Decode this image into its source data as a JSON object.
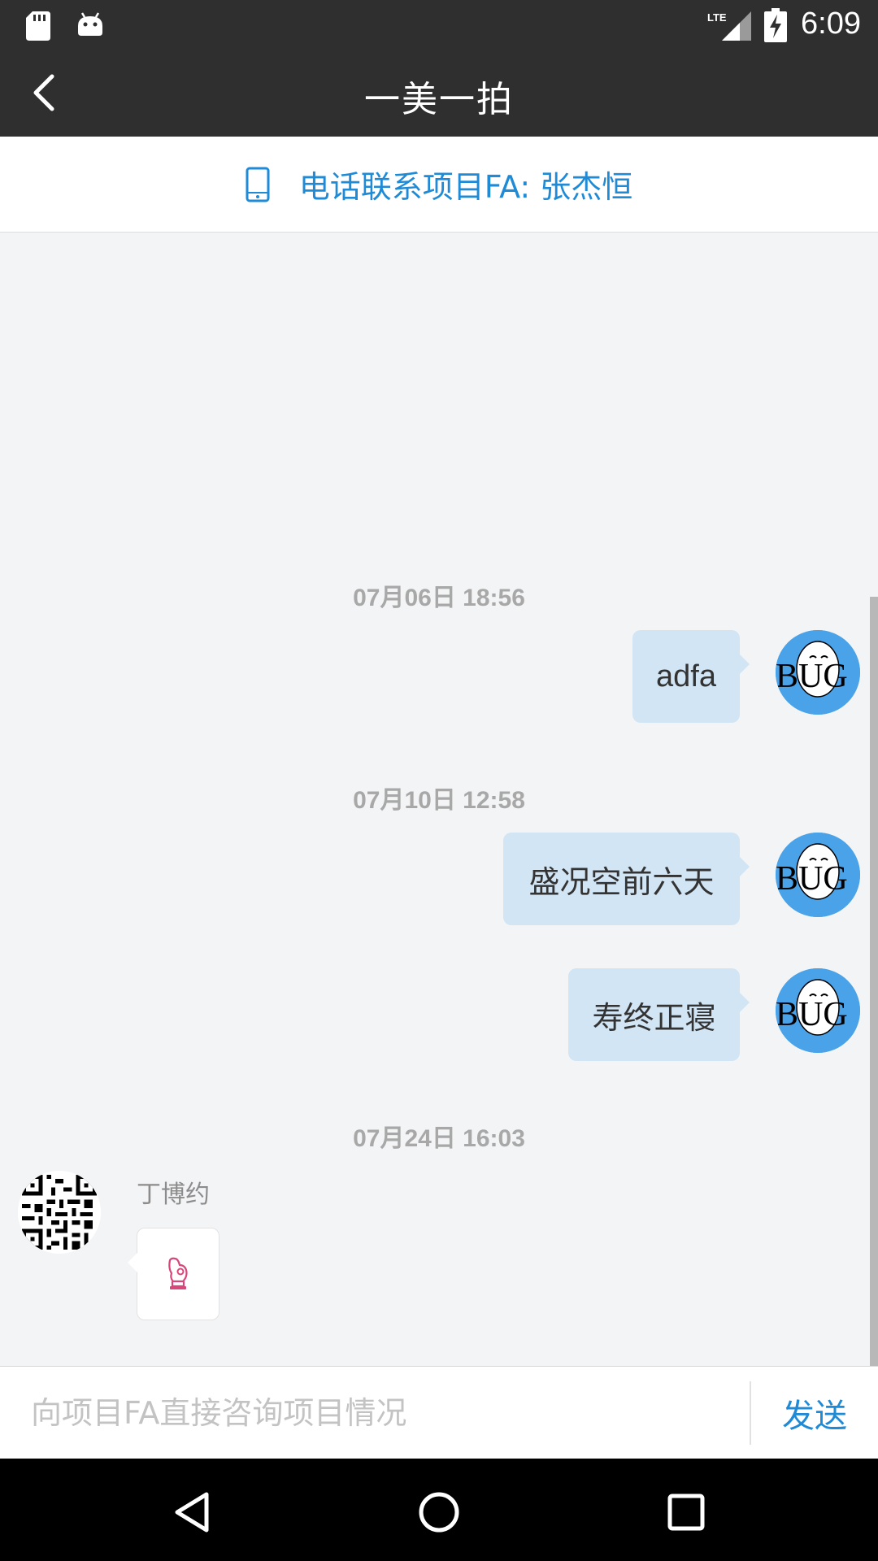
{
  "status_bar": {
    "time": "6:09",
    "network": "LTE",
    "icons": [
      "sd-card-icon",
      "android-icon",
      "signal-icon",
      "battery-charging-icon"
    ]
  },
  "toolbar": {
    "title": "一美一拍",
    "back_icon": "chevron-left-icon"
  },
  "fa_bar": {
    "label": "电话联系项目FA: 张杰恒",
    "icon": "phone-icon",
    "accent_color": "#1f8ad6"
  },
  "messages": [
    {
      "timestamp": "07月06日 18:56",
      "text": "adfa",
      "side": "right"
    },
    {
      "timestamp": "07月10日 12:58",
      "text": "盛况空前六天",
      "side": "right"
    },
    {
      "text": "寿终正寝",
      "side": "right"
    },
    {
      "timestamp": "07月24日 16:03",
      "sender": "丁博约",
      "content": "ok-hand-emoji",
      "side": "left"
    }
  ],
  "my_avatar": {
    "text": "BUG",
    "color": "#4aa3e9"
  },
  "input": {
    "placeholder": "向项目FA直接咨询项目情况",
    "value": "",
    "send_label": "发送"
  },
  "nav_bar": {
    "icons": [
      "back-triangle-icon",
      "home-circle-icon",
      "recents-square-icon"
    ]
  }
}
